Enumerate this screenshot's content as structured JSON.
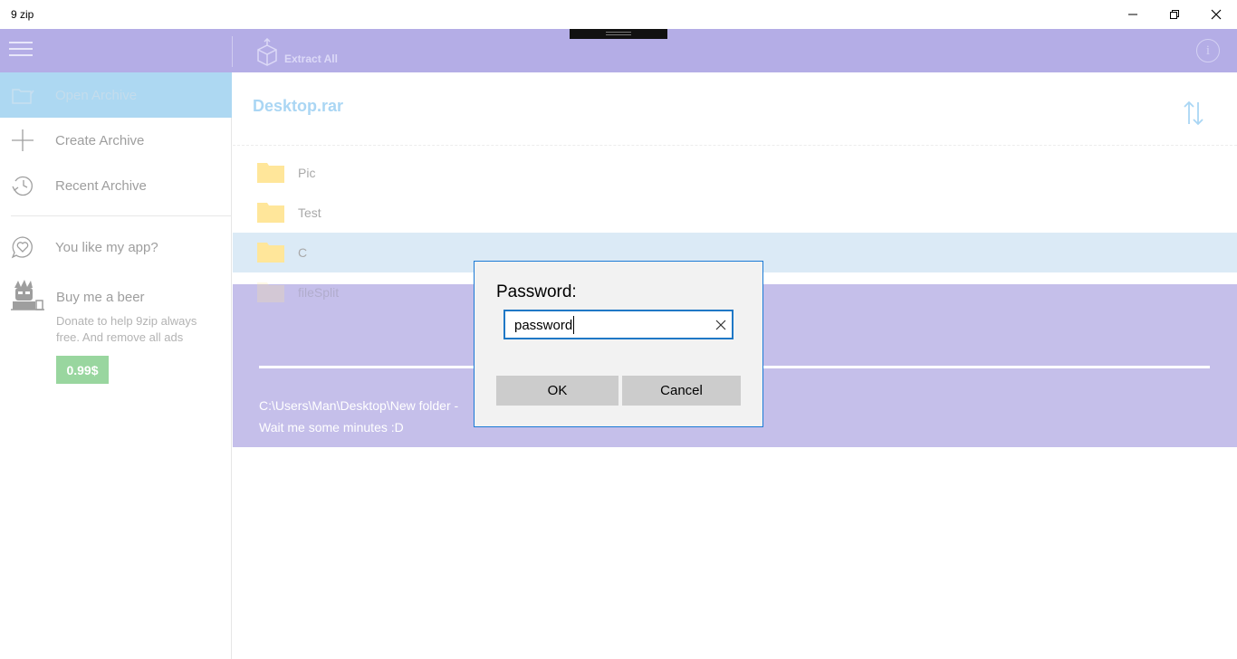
{
  "window": {
    "title": "9 zip"
  },
  "toolbar": {
    "extract_label": "Extract All",
    "info_glyph": "i"
  },
  "sidebar": {
    "items": [
      {
        "label": "Open Archive",
        "icon": "folder-open-icon",
        "active": true
      },
      {
        "label": "Create Archive",
        "icon": "plus-icon"
      },
      {
        "label": "Recent Archive",
        "icon": "history-icon"
      },
      {
        "label": "You like my app?",
        "icon": "heart-bubble-icon"
      }
    ],
    "beer": {
      "title": "Buy me a beer",
      "description": "Donate to help 9zip always free. And remove all ads",
      "price": "0.99$"
    }
  },
  "archive": {
    "name": "Desktop.rar",
    "files": [
      {
        "name": "Pic"
      },
      {
        "name": "Test"
      },
      {
        "name": "C",
        "selected": true
      },
      {
        "name": "fileSplit"
      }
    ]
  },
  "progress": {
    "path": "C:\\Users\\Man\\Desktop\\New folder -",
    "message": "Wait me some minutes :D"
  },
  "dialog": {
    "title": "Password:",
    "password_value": "password",
    "ok_label": "OK",
    "cancel_label": "Cancel"
  },
  "colors": {
    "appbar": "#b4ade6",
    "progress_panel": "#c5bfea",
    "active_nav": "#add8f2",
    "selected_row": "#dbeaf6",
    "price_button": "#99d69f",
    "folder": "#ffe69a",
    "accent_blue": "#1f78c6"
  }
}
